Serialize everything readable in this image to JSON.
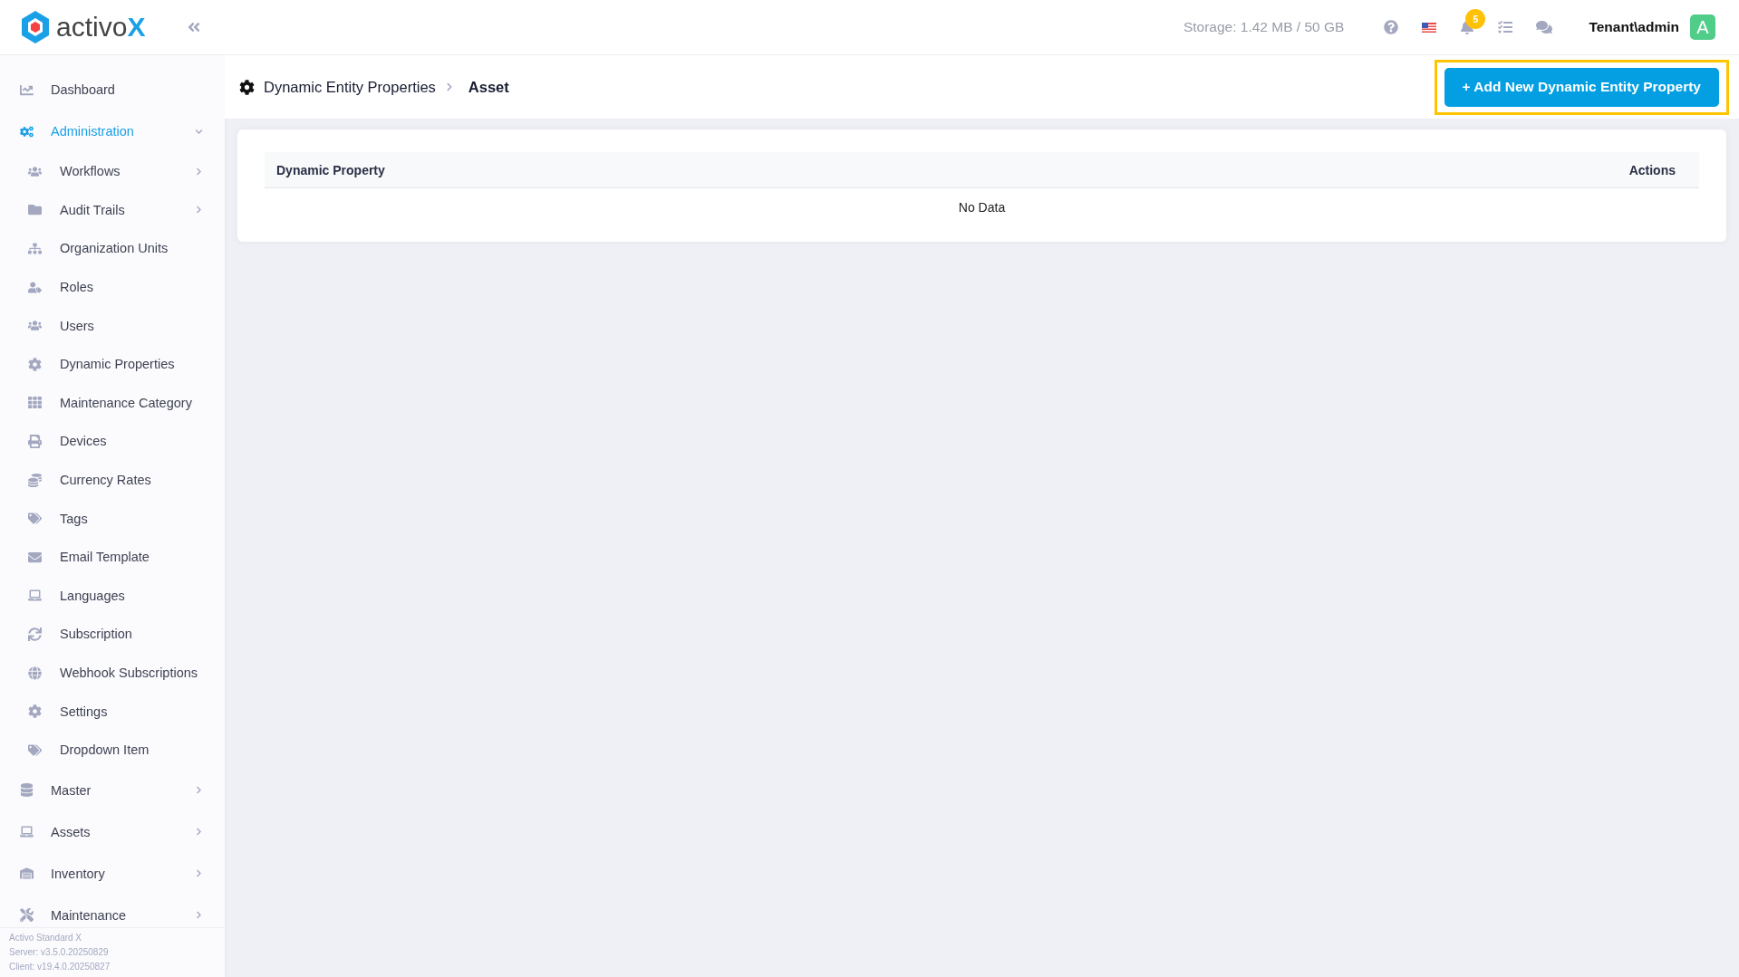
{
  "logo": {
    "text": "activo",
    "accent": "X"
  },
  "sidebar": {
    "items": [
      {
        "label": "Dashboard",
        "selected": false,
        "has_arrow": false
      },
      {
        "label": "Administration",
        "selected": true,
        "has_arrow": true,
        "expanded": true,
        "children": [
          {
            "label": "Workflows",
            "has_arrow": true
          },
          {
            "label": "Audit Trails",
            "has_arrow": true
          },
          {
            "label": "Organization Units",
            "has_arrow": false
          },
          {
            "label": "Roles",
            "has_arrow": false
          },
          {
            "label": "Users",
            "has_arrow": false
          },
          {
            "label": "Dynamic Properties",
            "has_arrow": false
          },
          {
            "label": "Maintenance Category",
            "has_arrow": false
          },
          {
            "label": "Devices",
            "has_arrow": false
          },
          {
            "label": "Currency Rates",
            "has_arrow": false
          },
          {
            "label": "Tags",
            "has_arrow": false
          },
          {
            "label": "Email Template",
            "has_arrow": false
          },
          {
            "label": "Languages",
            "has_arrow": false
          },
          {
            "label": "Subscription",
            "has_arrow": false
          },
          {
            "label": "Webhook Subscriptions",
            "has_arrow": false
          },
          {
            "label": "Settings",
            "has_arrow": false
          },
          {
            "label": "Dropdown Item",
            "has_arrow": false
          }
        ]
      },
      {
        "label": "Master",
        "selected": false,
        "has_arrow": true,
        "expanded": false
      },
      {
        "label": "Assets",
        "selected": false,
        "has_arrow": true,
        "expanded": false
      },
      {
        "label": "Inventory",
        "selected": false,
        "has_arrow": true,
        "expanded": false
      },
      {
        "label": "Maintenance",
        "selected": false,
        "has_arrow": true,
        "expanded": false
      }
    ],
    "footer": [
      "Activo Standard X",
      "Server: v3.5.0.20250829",
      "Client: v19.4.0.20250827"
    ]
  },
  "header": {
    "storage": "Storage: 1.42 MB / 50 GB",
    "notification_count": "5",
    "user": "Tenant\\admin",
    "avatar": "A"
  },
  "breadcrumb": [
    "Dynamic Entity Properties",
    "Asset"
  ],
  "add_button": {
    "label": "+ Add New Dynamic Entity Property",
    "highlighted": true
  },
  "table": {
    "columns": [
      "Dynamic Property",
      "Actions"
    ],
    "empty_text": "No Data"
  }
}
